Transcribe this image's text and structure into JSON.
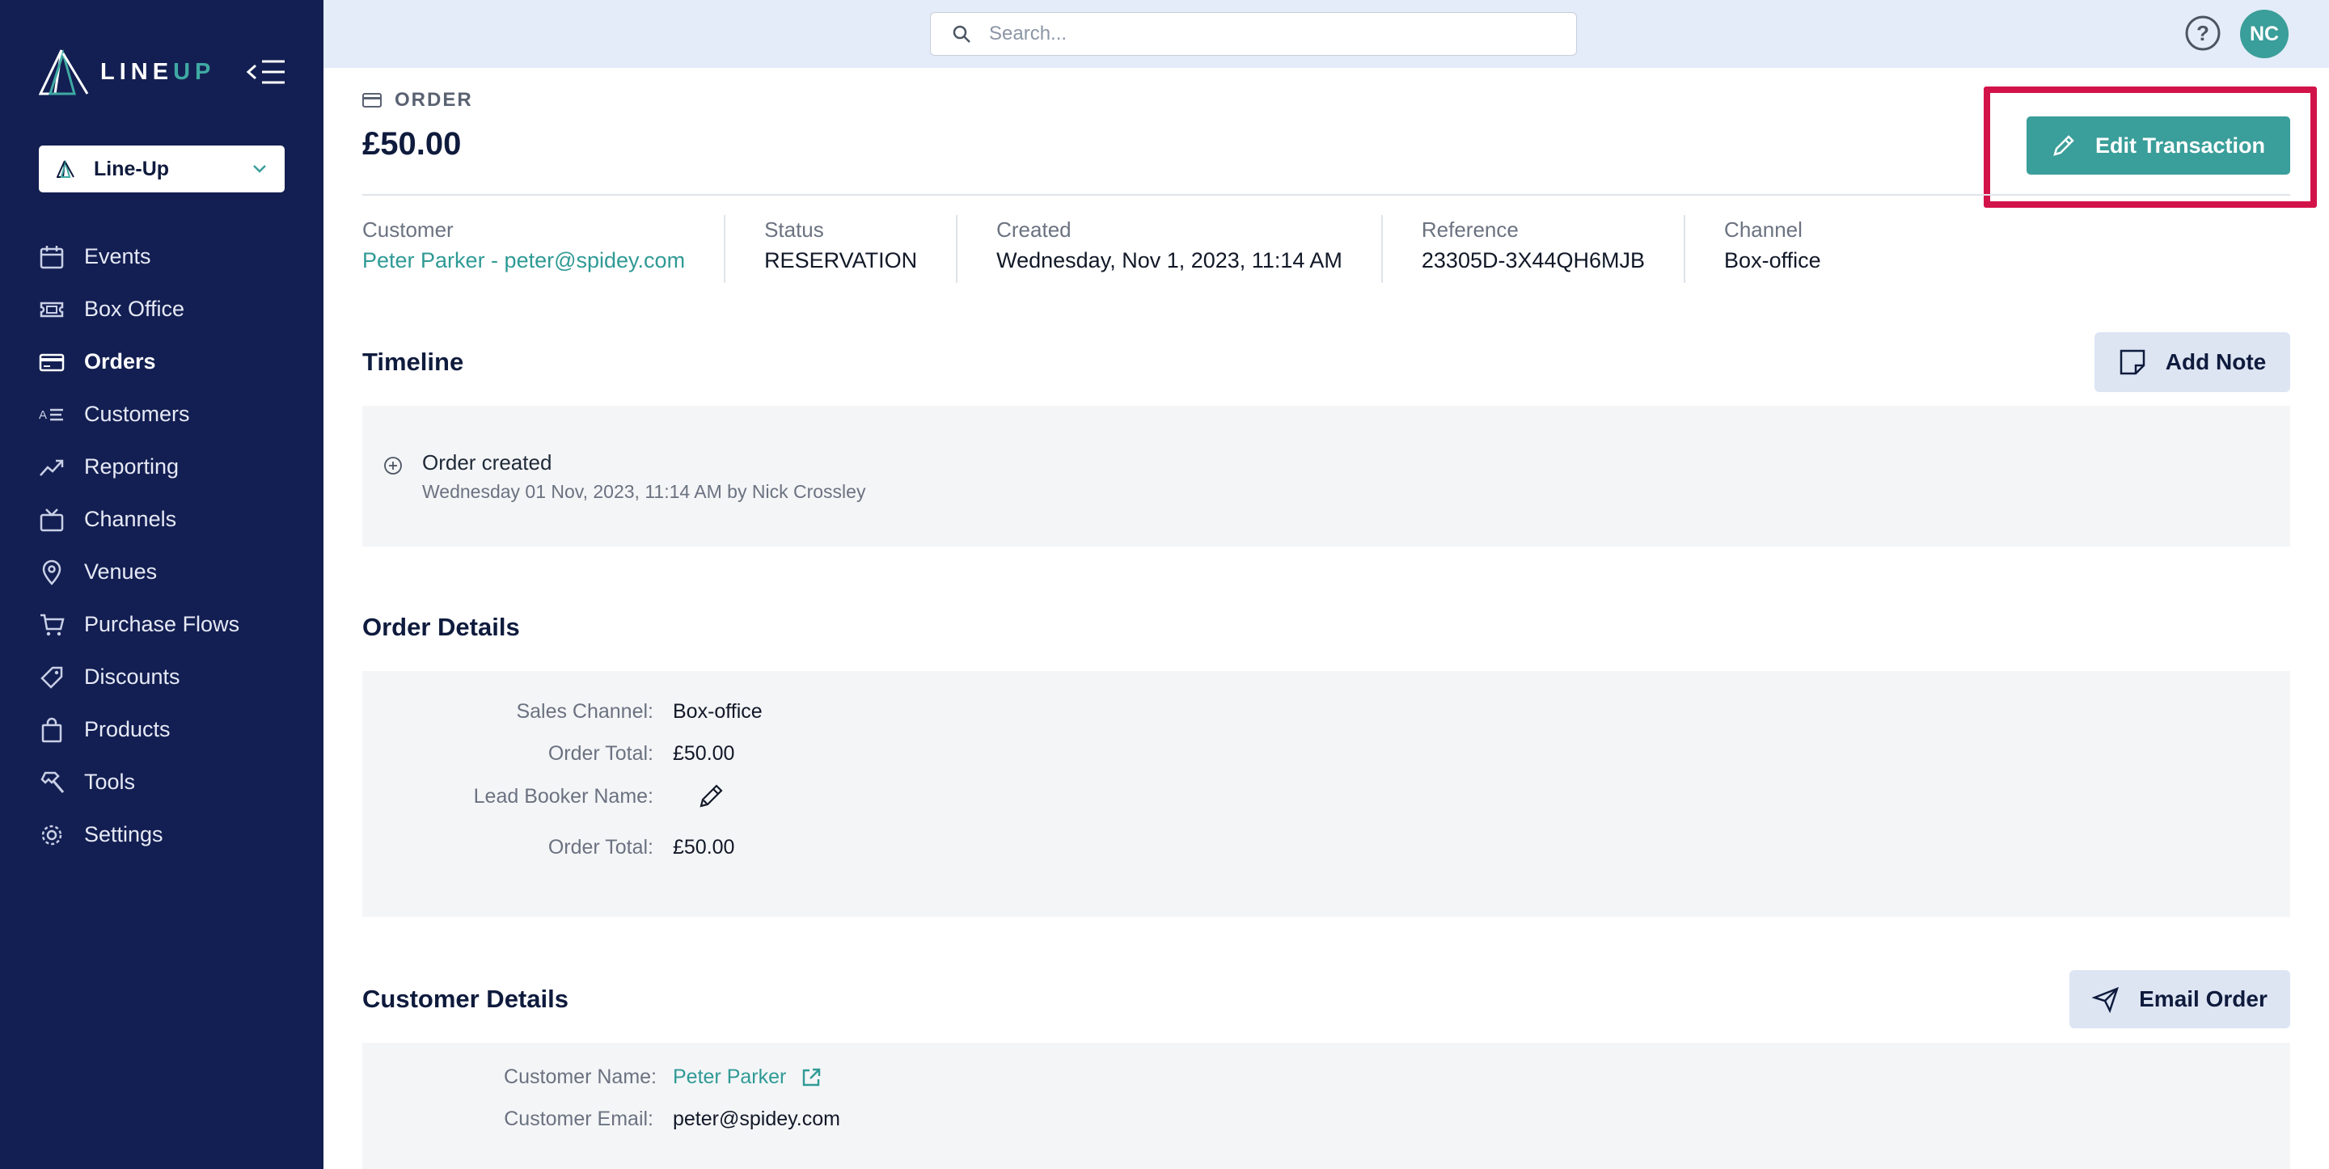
{
  "brand": {
    "name_part1": "LINE",
    "name_part2": "UP"
  },
  "org_selector": {
    "value": "Line-Up"
  },
  "nav": [
    {
      "label": "Events",
      "icon": "calendar-icon"
    },
    {
      "label": "Box Office",
      "icon": "ticket-icon"
    },
    {
      "label": "Orders",
      "icon": "card-icon",
      "active": true
    },
    {
      "label": "Customers",
      "icon": "contacts-icon"
    },
    {
      "label": "Reporting",
      "icon": "trend-icon"
    },
    {
      "label": "Channels",
      "icon": "tv-icon"
    },
    {
      "label": "Venues",
      "icon": "pin-icon"
    },
    {
      "label": "Purchase Flows",
      "icon": "cart-icon"
    },
    {
      "label": "Discounts",
      "icon": "tag-icon"
    },
    {
      "label": "Products",
      "icon": "bag-icon"
    },
    {
      "label": "Tools",
      "icon": "hammer-icon"
    },
    {
      "label": "Settings",
      "icon": "gear-icon"
    }
  ],
  "search": {
    "placeholder": "Search..."
  },
  "user": {
    "initials": "NC"
  },
  "order": {
    "eyebrow": "ORDER",
    "amount": "£50.00",
    "edit_label": "Edit Transaction",
    "meta": {
      "customer_label": "Customer",
      "customer_value": "Peter Parker - peter@spidey.com",
      "status_label": "Status",
      "status_value": "RESERVATION",
      "created_label": "Created",
      "created_value": "Wednesday, Nov 1, 2023, 11:14 AM",
      "reference_label": "Reference",
      "reference_value": "23305D-3X44QH6MJB",
      "channel_label": "Channel",
      "channel_value": "Box-office"
    }
  },
  "timeline": {
    "title": "Timeline",
    "add_note_label": "Add Note",
    "entries": [
      {
        "title": "Order created",
        "subtitle": "Wednesday 01 Nov, 2023, 11:14 AM by Nick Crossley"
      }
    ]
  },
  "order_details": {
    "title": "Order Details",
    "rows": [
      {
        "label": "Sales Channel:",
        "value": "Box-office"
      },
      {
        "label": "Order Total:",
        "value": "£50.00"
      },
      {
        "label": "Lead Booker Name:",
        "value": ""
      },
      {
        "label": "Order Total:",
        "value": "£50.00"
      }
    ]
  },
  "customer_details": {
    "title": "Customer Details",
    "email_label": "Email Order",
    "rows": [
      {
        "label": "Customer Name:",
        "value": "Peter Parker"
      },
      {
        "label": "Customer Email:",
        "value": "peter@spidey.com"
      }
    ]
  },
  "colors": {
    "sidebar": "#131f52",
    "accent": "#3a9e9a",
    "highlight": "#d2134a",
    "topbar": "#e3ecf8"
  }
}
